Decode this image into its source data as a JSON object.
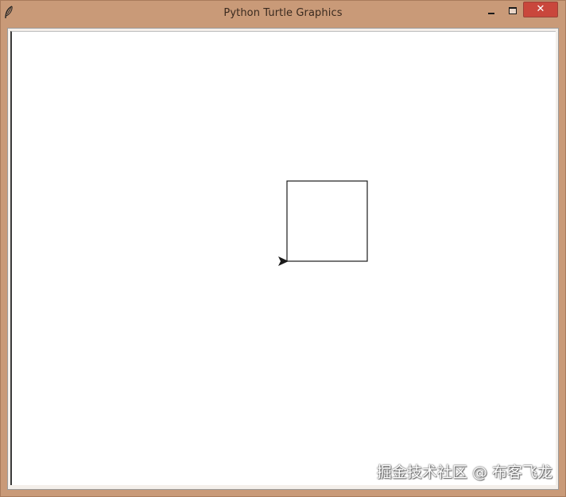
{
  "window": {
    "title": "Python Turtle Graphics",
    "controls": {
      "minimize_icon": "minimize-icon",
      "maximize_icon": "maximize-icon",
      "close_label": "✕"
    },
    "frame_color": "#c99a78",
    "close_color": "#c9473c"
  },
  "canvas": {
    "background": "#ffffff",
    "drawing": {
      "shape": "square",
      "turtle_shape": "arrow",
      "turtle_heading": "east",
      "pen_color": "#1a1a1a"
    }
  },
  "watermark": {
    "text": "掘金技术社区 @ 布客飞龙"
  }
}
